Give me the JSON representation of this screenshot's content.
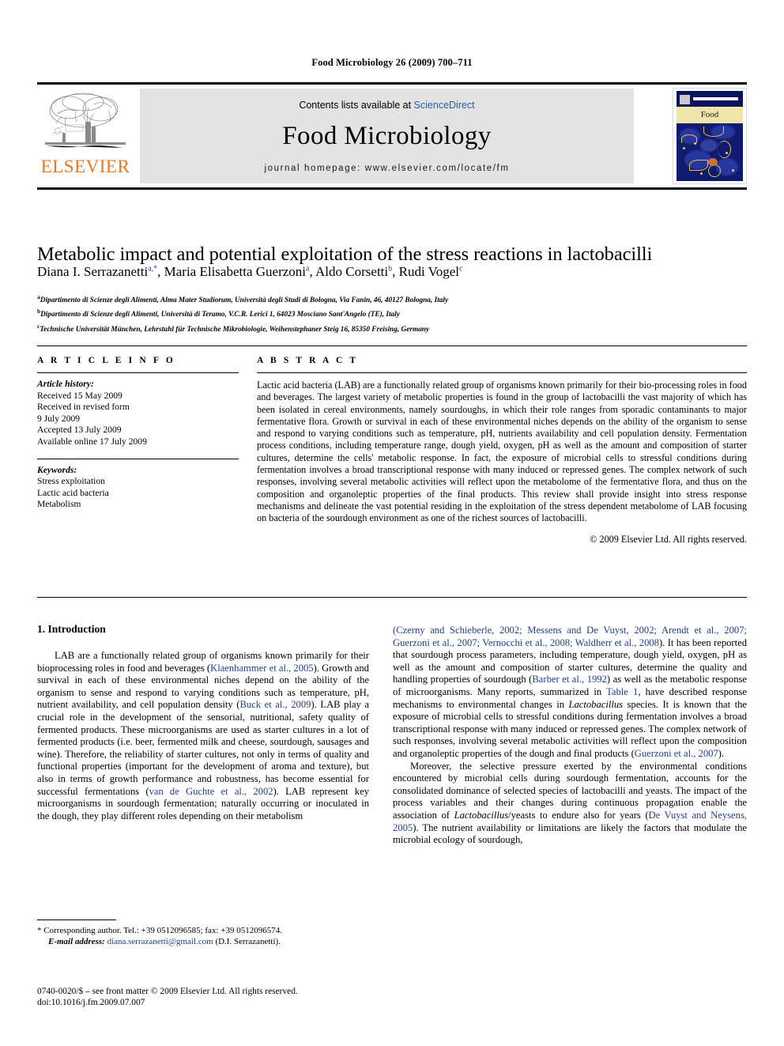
{
  "running_head": "Food Microbiology 26 (2009) 700–711",
  "masthead": {
    "publisher_logo_label": "ELSEVIER",
    "publisher_logo_icon": "elsevier-tree-logo",
    "contents_prefix": "Contents lists available at ",
    "contents_link": "ScienceDirect",
    "journal_title": "Food Microbiology",
    "homepage": "journal homepage: www.elsevier.com/locate/fm",
    "cover_title": "Food Microbiology"
  },
  "article": {
    "title": "Metabolic impact and potential exploitation of the stress reactions in lactobacilli",
    "authors": [
      {
        "name": "Diana I. Serrazanetti",
        "marks": "a,*"
      },
      {
        "name": "Maria Elisabetta Guerzoni",
        "marks": "a"
      },
      {
        "name": "Aldo Corsetti",
        "marks": "b"
      },
      {
        "name": "Rudi Vogel",
        "marks": "c"
      }
    ],
    "affiliations": [
      {
        "mark": "a",
        "text": "Dipartimento di Scienze degli Alimenti, Alma Mater Studiorum, Università degli Studi di Bologna, Via Fanin, 46, 40127 Bologna, Italy"
      },
      {
        "mark": "b",
        "text": "Dipartimento di Scienze degli Alimenti, Università di Teramo, V.C.R. Lerici 1, 64023 Mosciano Sant'Angelo (TE), Italy"
      },
      {
        "mark": "c",
        "text": "Technische Universität München, Lehrstuhl für Technische Mikrobiologie, Weihenstephaner Steig 16, 85350 Freising, Germany"
      }
    ]
  },
  "article_info": {
    "heading": "A R T I C L E  I N F O",
    "history_label": "Article history:",
    "history": [
      "Received 15 May 2009",
      "Received in revised form",
      "9 July 2009",
      "Accepted 13 July 2009",
      "Available online 17 July 2009"
    ],
    "keywords_label": "Keywords:",
    "keywords": [
      "Stress exploitation",
      "Lactic acid bacteria",
      "Metabolism"
    ]
  },
  "abstract": {
    "heading": "A B S T R A C T",
    "text": "Lactic acid bacteria (LAB) are a functionally related group of organisms known primarily for their bio-processing roles in food and beverages. The largest variety of metabolic properties is found in the group of lactobacilli the vast majority of which has been isolated in cereal environments, namely sourdoughs, in which their role ranges from sporadic contaminants to major fermentative flora. Growth or survival in each of these environmental niches depends on the ability of the organism to sense and respond to varying conditions such as temperature, pH, nutrients availability and cell population density. Fermentation process conditions, including temperature range, dough yield, oxygen, pH as well as the amount and composition of starter cultures, determine the cells' metabolic response. In fact, the exposure of microbial cells to stressful conditions during fermentation involves a broad transcriptional response with many induced or repressed genes. The complex network of such responses, involving several metabolic activities will reflect upon the metabolome of the fermentative flora, and thus on the composition and organoleptic properties of the final products. This review shall provide insight into stress response mechanisms and delineate the vast potential residing in the exploitation of the stress dependent metabolome of LAB focusing on bacteria of the sourdough environment as one of the richest sources of lactobacilli.",
    "copyright": "© 2009 Elsevier Ltd. All rights reserved."
  },
  "section": {
    "number_and_title": "1.  Introduction"
  },
  "body": {
    "left_p1_a": "LAB are a functionally related group of organisms known primarily for their bioprocessing roles in food and beverages (",
    "left_cite1": "Klaenhammer et al., 2005",
    "left_p1_b": "). Growth and survival in each of these environmental niches depend on the ability of the organism to sense and respond to varying conditions such as temperature, pH, nutrient availability, and cell population density (",
    "left_cite2": "Buck et al., 2009",
    "left_p1_c": "). LAB play a crucial role in the development of the sensorial, nutritional, safety quality of fermented products. These microorganisms are used as starter cultures in a lot of fermented products (i.e. beer, fermented milk and cheese, sourdough, sausages and wine). Therefore, the reliability of starter cultures, not only in terms of quality and functional properties (important for the development of aroma and texture), but also in terms of growth performance and robustness, has become essential for successful fermentations (",
    "left_cite3": "van de Guchte et al., 2002",
    "left_p1_d": "). LAB represent key microorganisms in sourdough fermentation; naturally occurring or inoculated in the dough, they play different roles depending on their metabolism",
    "right_cite1": "(Czerny and Schieberle, 2002; Messens and De Vuyst, 2002; Arendt et al., 2007; Guerzoni et al., 2007; Vernocchi et al., 2008; Waldherr et al., 2008",
    "right_p1_a": "). It has been reported that sourdough process parameters, including temperature, dough yield, oxygen, pH as well as the amount and composition of starter cultures, determine the quality and handling properties of sourdough (",
    "right_cite2": "Barber et al., 1992",
    "right_p1_b": ") as well as the metabolic response of microorganisms. Many reports, summarized in ",
    "right_cite3": "Table 1",
    "right_p1_c": ", have described response mechanisms to environmental changes in ",
    "right_italic1": "Lactobacillus",
    "right_p1_d": " species. It is known that the exposure of microbial cells to stressful conditions during fermentation involves a broad transcriptional response with many induced or repressed genes. The complex network of such responses, involving several metabolic activities will reflect upon the composition and organoleptic properties of the dough and final products (",
    "right_cite4": "Guerzoni et al., 2007",
    "right_p1_e": ").",
    "right_p2_a": "Moreover, the selective pressure exerted by the environmental conditions encountered by microbial cells during sourdough fermentation, accounts for the consolidated dominance of selected species of lactobacilli and yeasts. The impact of the process variables and their changes during continuous propagation enable the association of ",
    "right_italic2": "Lactobacillus",
    "right_p2_b": "/yeasts to endure also for years (",
    "right_cite5": "De Vuyst and Neysens, 2005",
    "right_p2_c": "). The nutrient availability or limitations are likely the factors that modulate the microbial ecology of sourdough,"
  },
  "footnote": {
    "corresponding": "* Corresponding author. Tel.: +39 0512096585; fax: +39 0512096574.",
    "email_label": "E-mail address:",
    "email": "diana.serrazanetti@gmail.com",
    "email_suffix": "(D.I. Serrazanetti)."
  },
  "imprint": {
    "line1": "0740-0020/$ – see front matter © 2009 Elsevier Ltd. All rights reserved.",
    "line2": "doi:10.1016/j.fm.2009.07.007"
  },
  "colors": {
    "link_blue": "#2a5db0",
    "cite_blue": "#1f3f8f",
    "elsevier_orange": "#E87722",
    "masthead_grey": "#e3e3e3",
    "cover_navy": "#0b1260",
    "cover_band": "#efe5a8"
  }
}
